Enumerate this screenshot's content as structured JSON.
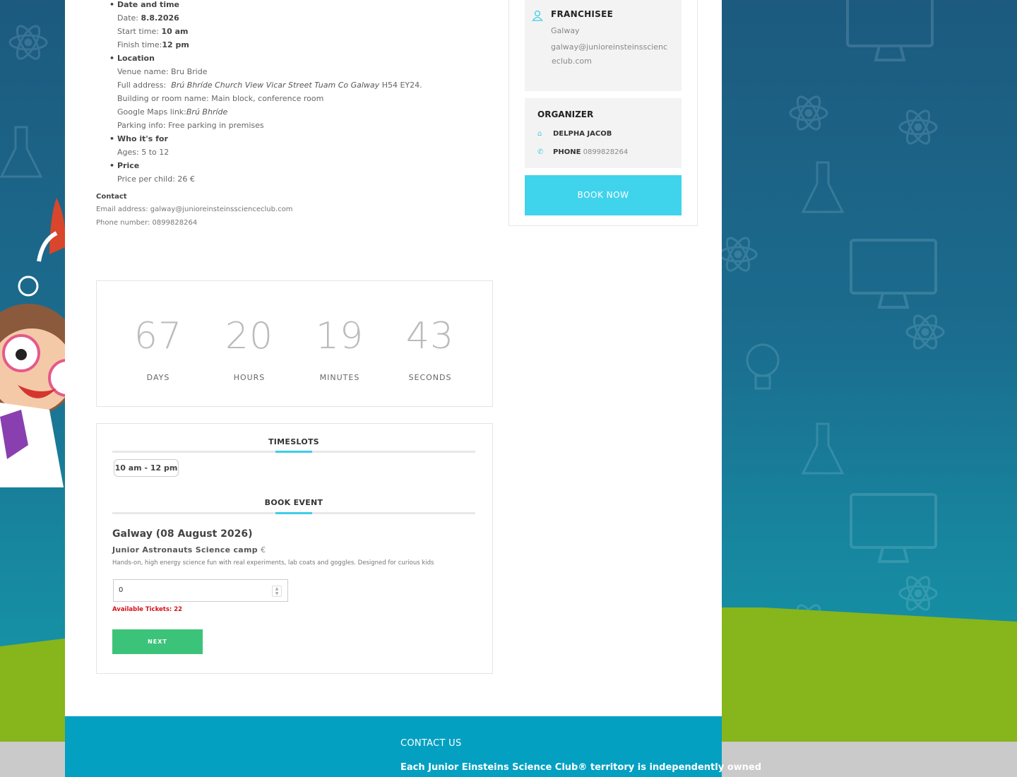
{
  "event_details": {
    "date_time_heading": "Date and time",
    "date_label": "Date:",
    "date_value": "8.8.2026",
    "start_label": "Start time:",
    "start_value": "10 am",
    "finish_label": "Finish time:",
    "finish_value": "12 pm",
    "location_heading": "Location",
    "venue": "Venue name: Bru Bride",
    "full_address_label": "Full address:",
    "full_address_italic": "Brú Bhríde Church View Vicar Street Tuam Co Galway",
    "full_address_code": "H54 EY24.",
    "building": "Building or room name: Main block, conference room",
    "maps_label": "Google Maps link:",
    "maps_link": "Brú Bhríde",
    "parking": "Parking info: Free parking in premises",
    "who_heading": "Who it's for",
    "ages": "Ages: 5 to 12",
    "price_heading": "Price",
    "price": "Price per child: 26 €"
  },
  "contact": {
    "heading": "Contact",
    "email": "Email address: galway@junioreinsteinsscienceclub.com",
    "phone": "Phone number: 0899828264"
  },
  "countdown": {
    "days": "67",
    "days_label": "DAYS",
    "hours": "20",
    "hours_label": "HOURS",
    "minutes": "19",
    "minutes_label": "MINUTES",
    "seconds": "43",
    "seconds_label": "SECONDS"
  },
  "booking": {
    "timeslots_title": "TIMESLOTS",
    "timeslot": "10 am - 12 pm",
    "book_event_title": "BOOK EVENT",
    "event_title": "Galway (08 August 2026)",
    "ticket_name": "Junior Astronauts Science camp",
    "ticket_currency": "€",
    "ticket_desc": "Hands-on, high energy science fun with real experiments, lab coats and goggles. Designed for curious kids",
    "quantity": "0",
    "available": "Available Tickets: 22",
    "next_label": "NEXT"
  },
  "sidebar": {
    "franchisee_title": "FRANCHISEE",
    "franchisee_name": "Galway",
    "franchisee_email_1": "galway@junioreinsteinsscienc",
    "franchisee_email_2": "eclub.com",
    "organizer_title": "ORGANIZER",
    "organizer_name": "DELPHA JACOB",
    "phone_label": "PHONE",
    "phone_value": "0899828264",
    "book_now": "BOOK NOW"
  },
  "footer": {
    "contact_us": "CONTACT US",
    "text": "Each Junior Einsteins Science Club® territory is independently owned"
  },
  "colors": {
    "accent": "#40d3ec",
    "next_button": "#3cc37a",
    "footer": "#03a0c2",
    "alert": "#d4121a"
  }
}
